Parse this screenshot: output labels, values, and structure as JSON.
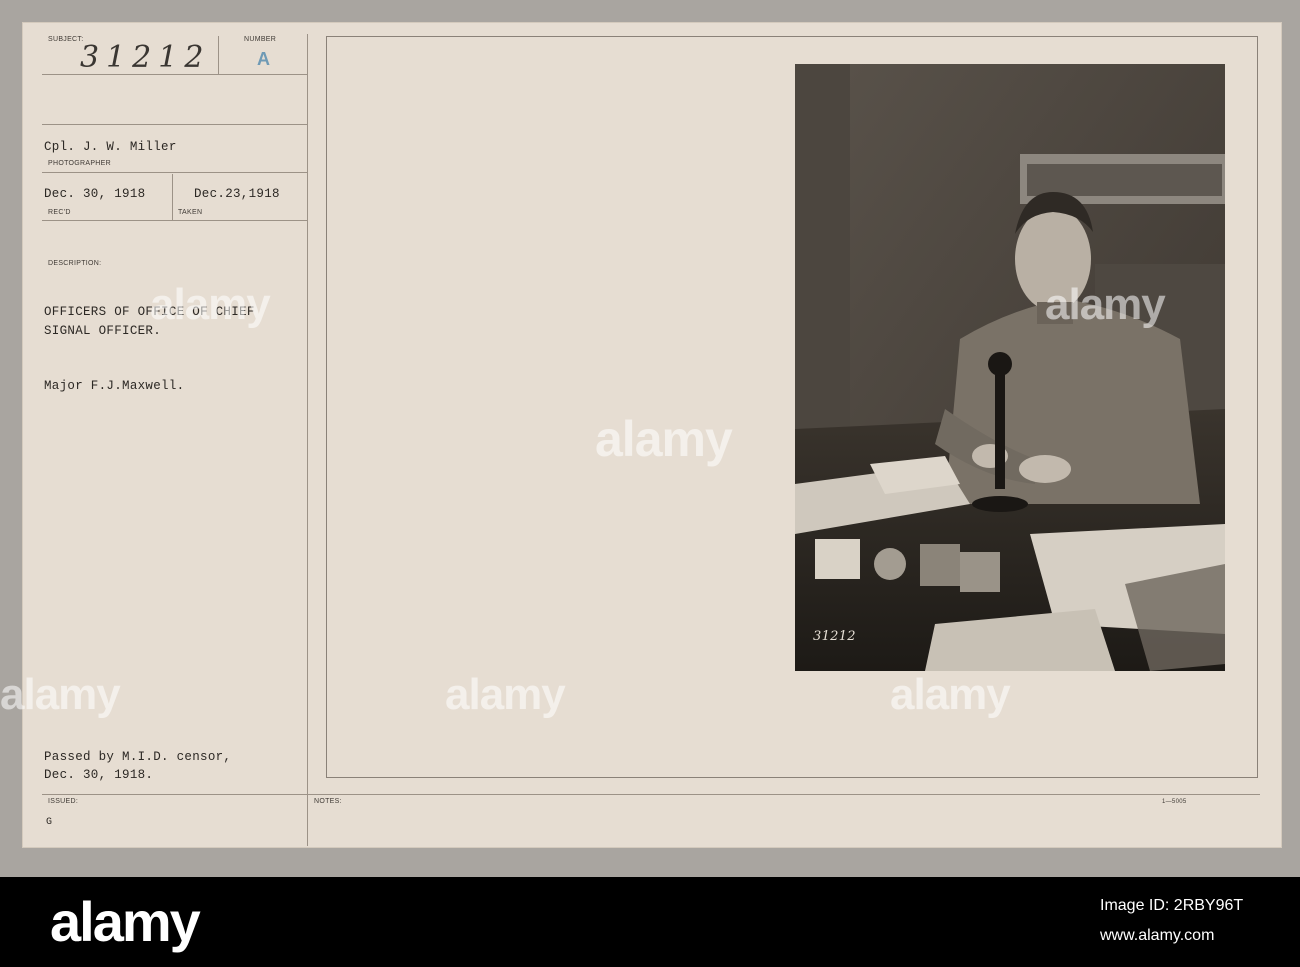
{
  "card": {
    "subject_label": "SUBJECT:",
    "subject_value": "31212",
    "number_label": "NUMBER",
    "number_value": "A",
    "photographer_value": "Cpl. J. W. Miller",
    "photographer_label": "PHOTOGRAPHER",
    "recd_value": "Dec. 30, 1918",
    "recd_label": "REC'D",
    "taken_value": "Dec.23,1918",
    "taken_label": "TAKEN",
    "description_label": "DESCRIPTION:",
    "description_line1": "OFFICERS OF OFFICE OF CHIEF",
    "description_line2": "SIGNAL OFFICER.",
    "subject_name": "Major F.J.Maxwell.",
    "censor_line1": "Passed by M.I.D. censor,",
    "censor_line2": "Dec. 30, 1918.",
    "issued_label": "ISSUED:",
    "issued_value": "G",
    "notes_label": "NOTES:",
    "form_code": "1—5005"
  },
  "photo": {
    "negative_number": "31212"
  },
  "watermark": {
    "text": "alamy",
    "id_label": "Image ID: 2RBY96T",
    "url": "www.alamy.com"
  }
}
